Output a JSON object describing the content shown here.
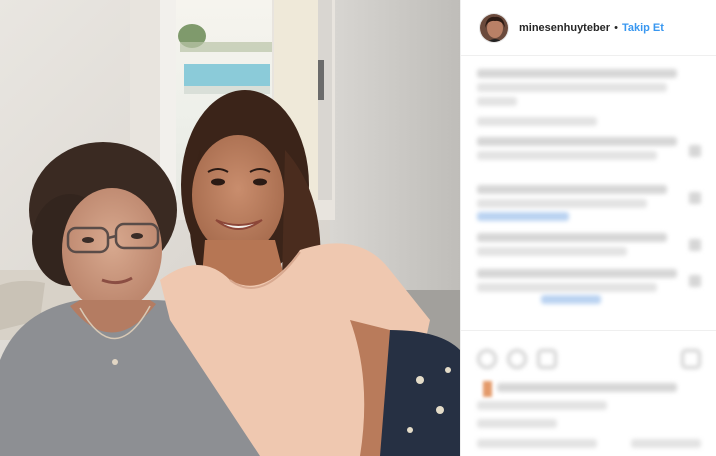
{
  "post": {
    "username": "minesenhuyteber",
    "separator": "•",
    "follow_label": "Takip Et"
  },
  "icons": {
    "avatar": "profile-photo",
    "like": "heart-icon",
    "comment": "comment-icon",
    "share": "share-icon",
    "bookmark": "bookmark-icon"
  },
  "colors": {
    "follow_link": "#3897f0",
    "username": "#262626",
    "divider": "#efefef"
  }
}
